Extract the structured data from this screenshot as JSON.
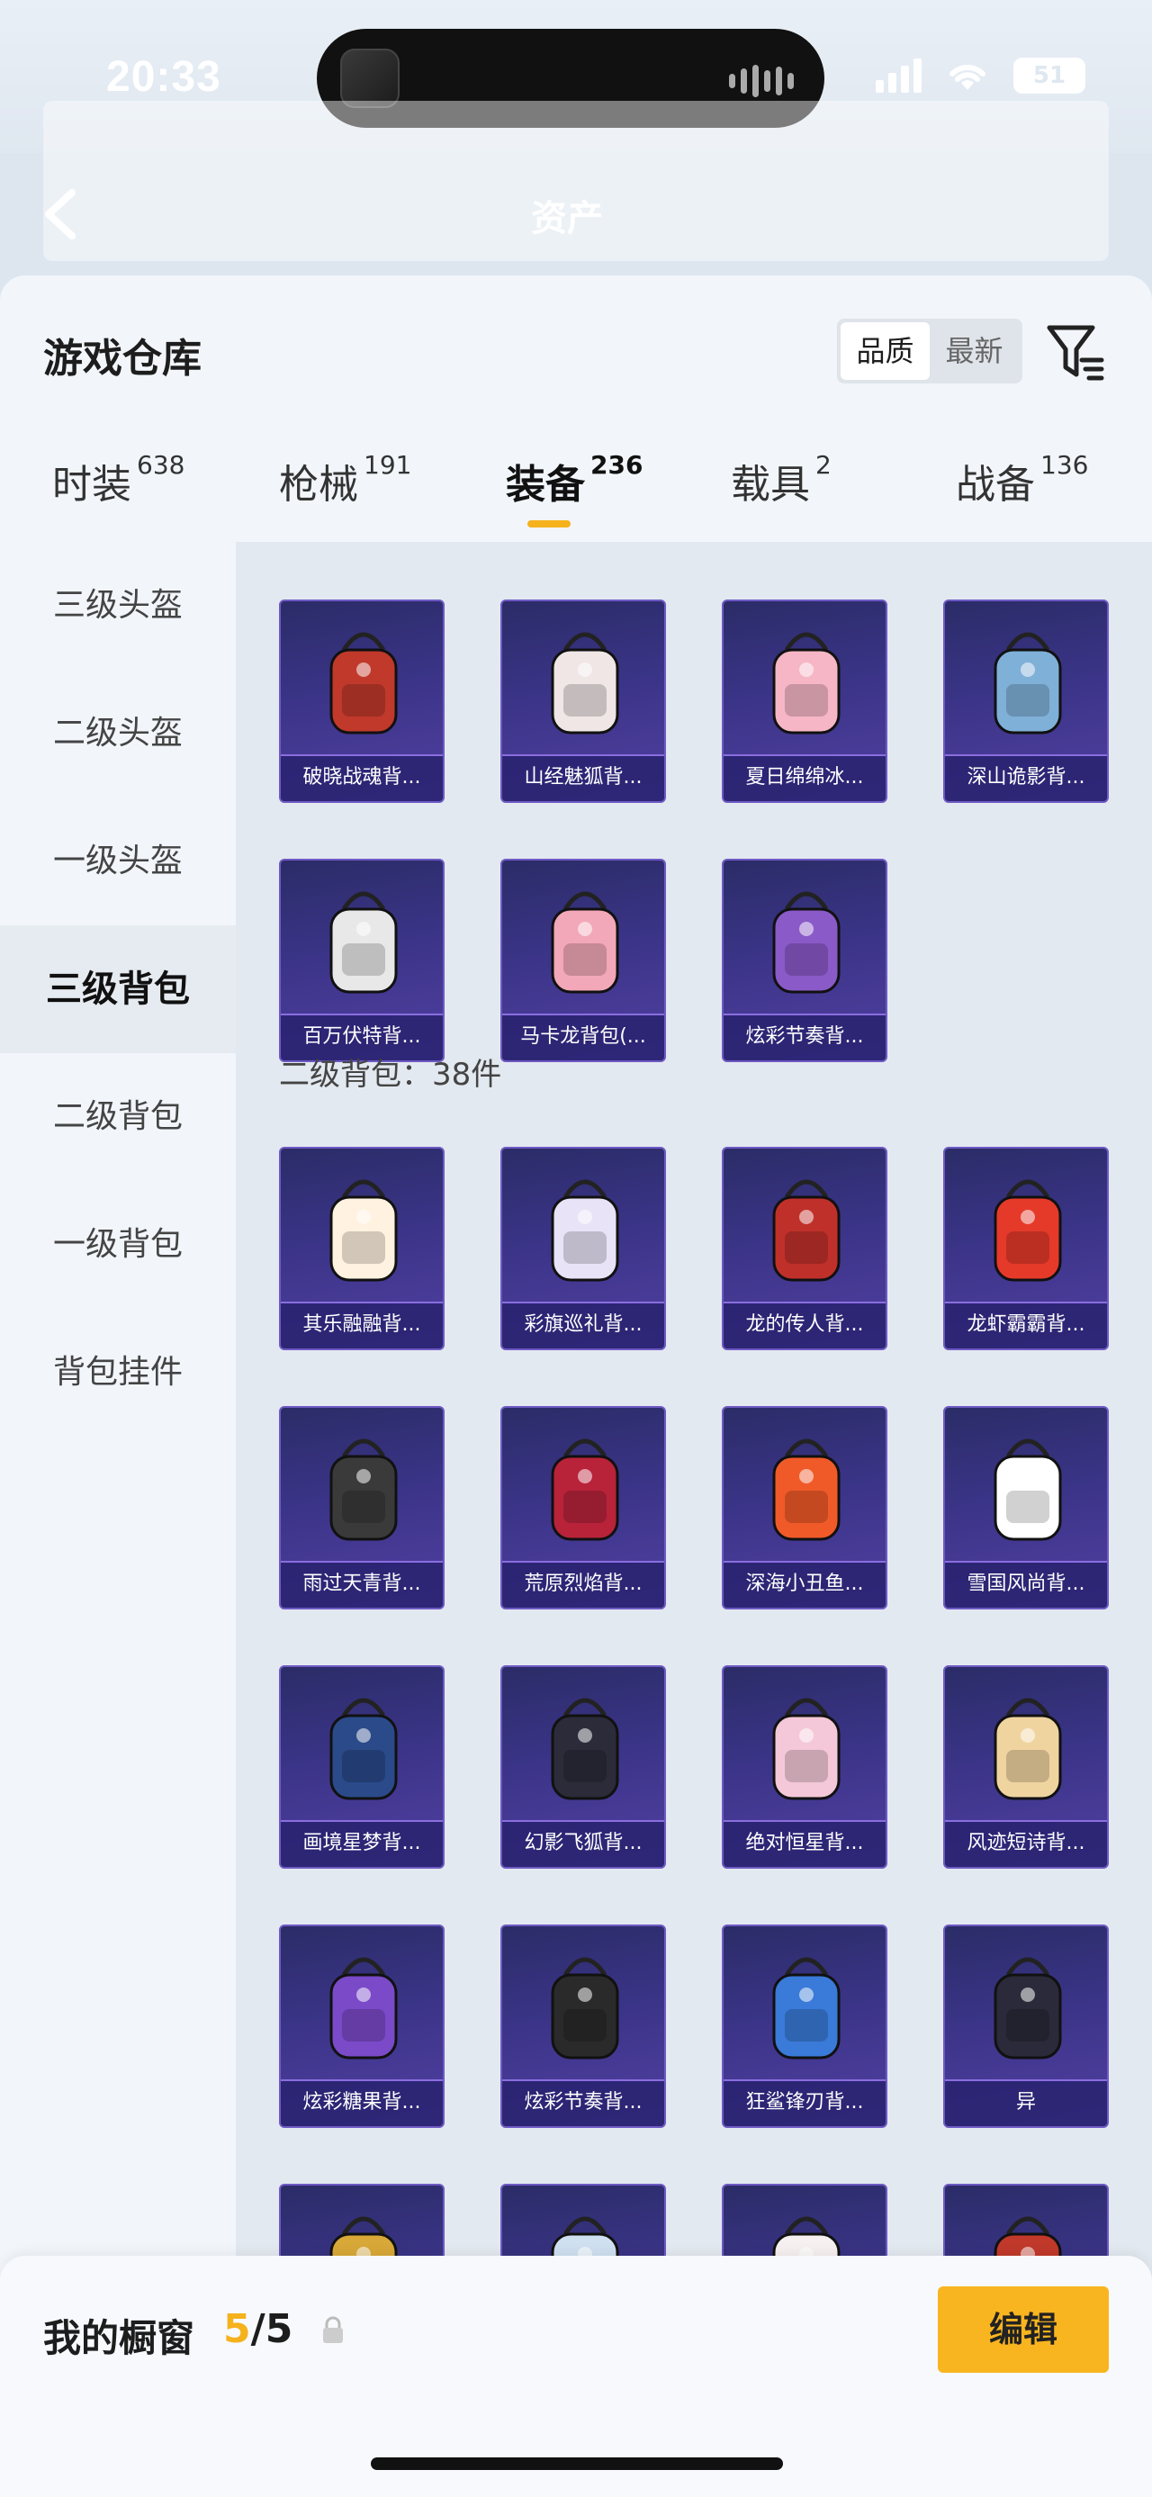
{
  "status": {
    "time": "20:33",
    "battery": "51"
  },
  "nav": {
    "title": "资产"
  },
  "header": {
    "title": "游戏仓库",
    "sort_options": [
      "品质",
      "最新"
    ],
    "active_sort": "品质"
  },
  "tabs": [
    {
      "label": "时装",
      "count": "638"
    },
    {
      "label": "枪械",
      "count": "191"
    },
    {
      "label": "装备",
      "count": "236"
    },
    {
      "label": "载具",
      "count": "2"
    },
    {
      "label": "战备",
      "count": "136"
    }
  ],
  "active_tab": "装备",
  "sidebar": {
    "items": [
      {
        "label": "三级头盔"
      },
      {
        "label": "二级头盔"
      },
      {
        "label": "一级头盔"
      },
      {
        "label": "三级背包"
      },
      {
        "label": "二级背包"
      },
      {
        "label": "一级背包"
      },
      {
        "label": "背包挂件"
      }
    ],
    "active": "三级背包"
  },
  "section_label": "二级背包：38件",
  "items_level3": [
    {
      "name": "破晓战魂背...",
      "icon": "dark-red-backpack"
    },
    {
      "name": "山经魅狐背...",
      "icon": "white-fox-backpack"
    },
    {
      "name": "夏日绵绵冰...",
      "icon": "ice-cream-backpack"
    },
    {
      "name": "深山诡影背...",
      "icon": "blue-backpack"
    },
    {
      "name": "百万伏特背...",
      "icon": "white-mech-backpack"
    },
    {
      "name": "马卡龙背包(...",
      "icon": "pink-backpack"
    },
    {
      "name": "炫彩节奏背...",
      "icon": "purple-graffiti-backpack"
    }
  ],
  "items_level2": [
    {
      "name": "其乐融融背...",
      "icon": "cake-backpack"
    },
    {
      "name": "彩旗巡礼背...",
      "icon": "bow-backpack"
    },
    {
      "name": "龙的传人背...",
      "icon": "red-backpack"
    },
    {
      "name": "龙虾霸霸背...",
      "icon": "lobster-backpack"
    },
    {
      "name": "雨过天青背...",
      "icon": "teal-vase-backpack"
    },
    {
      "name": "荒原烈焰背...",
      "icon": "black-red-backpack"
    },
    {
      "name": "深海小丑鱼...",
      "icon": "clownfish-backpack"
    },
    {
      "name": "雪国风尚背...",
      "icon": "snowman-backpack"
    },
    {
      "name": "画境星梦背...",
      "icon": "book-backpack"
    },
    {
      "name": "幻影飞狐背...",
      "icon": "fox-black-backpack"
    },
    {
      "name": "绝对恒星背...",
      "icon": "popcorn-backpack"
    },
    {
      "name": "风迹短诗背...",
      "icon": "white-bag-backpack"
    },
    {
      "name": "炫彩糖果背...",
      "icon": "candy-backpack"
    },
    {
      "name": "炫彩节奏背...",
      "icon": "purple-backpack"
    },
    {
      "name": "狂鲨锋刃背...",
      "icon": "shark-backpack"
    },
    {
      "name": "异",
      "icon": "blue-mech-backpack"
    },
    {
      "name": "",
      "icon": "dark-backpack"
    },
    {
      "name": "",
      "icon": "gold-backpack"
    },
    {
      "name": "",
      "icon": "bunny-backpack"
    },
    {
      "name": "",
      "icon": "white-cat-backpack"
    }
  ],
  "showcase": {
    "label": "我的橱窗",
    "current": "5",
    "total": "/5",
    "edit_label": "编辑"
  }
}
